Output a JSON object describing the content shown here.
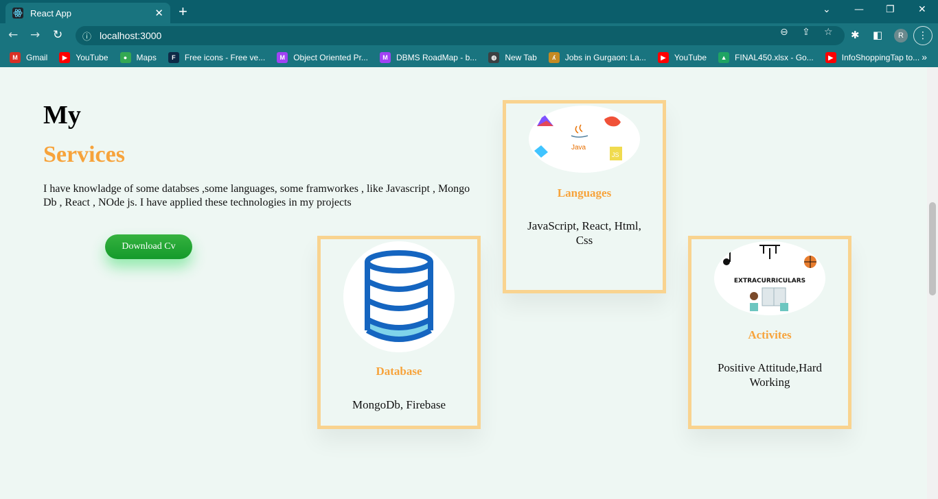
{
  "browser": {
    "tab_title": "React App",
    "tab_close": "✕",
    "new_tab": "+",
    "url": "localhost:3000",
    "profile_initial": "R",
    "window_controls": {
      "minimize": "—",
      "restore": "❐",
      "close": "✕"
    },
    "bookmarks": [
      {
        "label": "Gmail",
        "icon": "gmail-icon",
        "color": "#d93025",
        "glyph": "M"
      },
      {
        "label": "YouTube",
        "icon": "youtube-icon",
        "color": "#ff0000",
        "glyph": "▶"
      },
      {
        "label": "Maps",
        "icon": "maps-icon",
        "color": "#34a853",
        "glyph": "●"
      },
      {
        "label": "Free icons - Free ve...",
        "icon": "flaticon-icon",
        "color": "#0e2a47",
        "glyph": "F"
      },
      {
        "label": "Object Oriented Pr...",
        "icon": "m-icon",
        "color": "#a142f4",
        "glyph": "M"
      },
      {
        "label": "DBMS RoadMap - b...",
        "icon": "m-icon",
        "color": "#a142f4",
        "glyph": "M"
      },
      {
        "label": "New Tab",
        "icon": "globe-icon",
        "color": "#3c4043",
        "glyph": "◍"
      },
      {
        "label": "Jobs in Gurgaon: La...",
        "icon": "jobs-icon",
        "color": "#c58a22",
        "glyph": "ʎ"
      },
      {
        "label": "YouTube",
        "icon": "youtube-icon",
        "color": "#ff0000",
        "glyph": "▶"
      },
      {
        "label": "FINAL450.xlsx - Go...",
        "icon": "drive-icon",
        "color": "#1fa463",
        "glyph": "▲"
      },
      {
        "label": "InfoShoppingTap to...",
        "icon": "youtube-icon",
        "color": "#ff0000",
        "glyph": "▶"
      }
    ],
    "bookmarks_more": "»"
  },
  "hero": {
    "title_line1": "My",
    "title_line2": "Services",
    "description": "I have knowladge of some databses ,some languages, some framworkes , like Javascript , Mongo Db , React , NOde js. I have applied these technologies in my projects",
    "cv_button": "Download Cv"
  },
  "cards": {
    "languages": {
      "title": "Languages",
      "desc": "JavaScript, React, Html, Css",
      "logo_text": "Java"
    },
    "database": {
      "title": "Database",
      "desc": "MongoDb, Firebase"
    },
    "activities": {
      "title": "Activites",
      "desc": "Positive Attitude,Hard Working",
      "logo_text": "EXTRACURRICULARS"
    }
  },
  "colors": {
    "accent": "#f7a33b",
    "card_border": "#f9d38f",
    "button_green": "#1fa53a",
    "page_bg": "#eef7f3",
    "browser_frame": "#0b5e6b"
  }
}
